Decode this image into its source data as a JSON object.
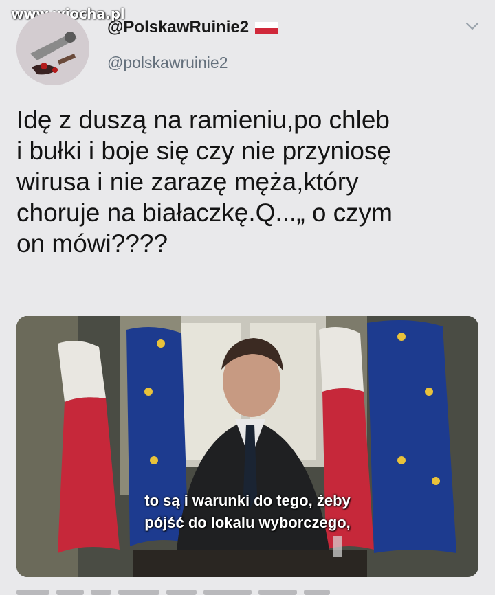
{
  "watermark": "www.wiocha.pl",
  "author": {
    "display_name": "@PolskawRuinie2",
    "handle": "@polskawruinie2"
  },
  "tweet": {
    "text": "Idę z duszą na ramieniu,po chleb\ni bułki i boje się czy nie przyniosę\nwirusa i nie zarazę męża,który\nchoruje na białaczkę.Q...„ o czym\non mówi????"
  },
  "media": {
    "subtitle_line1": "to są i warunki do tego, żeby",
    "subtitle_line2": "pójść do lokalu wyborczego,"
  },
  "colors": {
    "background": "#e9e9eb",
    "handle": "#64707c",
    "eu_blue": "#1d3b8f",
    "pl_red": "#d0283a"
  },
  "icons": [
    "poland-flag-icon",
    "chevron-down-icon"
  ]
}
